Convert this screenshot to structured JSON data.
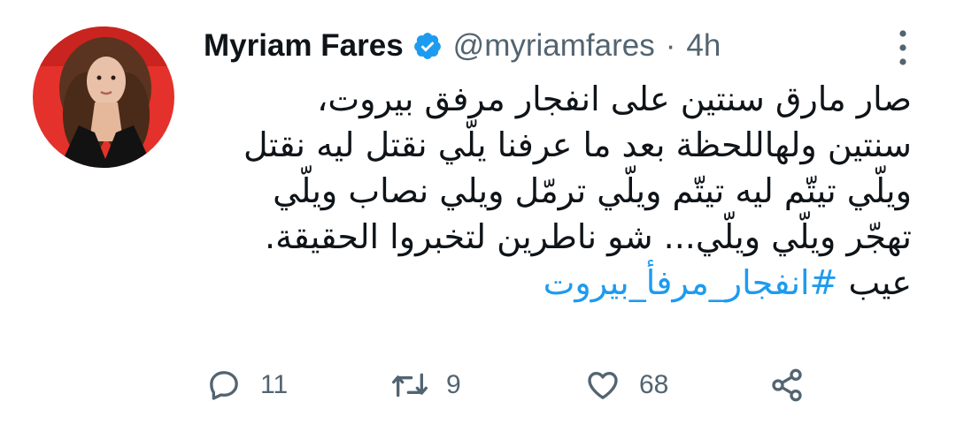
{
  "user": {
    "name": "Myriam Fares",
    "handle": "@myriamfares",
    "separator": "·",
    "time": "4h",
    "verified": true
  },
  "tweet": {
    "lines": [
      "صار مارق سنتين على انفجار مرفق بيروت،",
      "سنتين ولهاللحظة بعد ما عرفنا يلّي نقتل ليه نقتل",
      "ويلّي تيتّم ليه تيتّم  ويلّي ترمّل ويلي نصاب ويلّي",
      "تهجّر ويلّي ويلّي... شو ناطرين  لتخبروا الحقيقة."
    ],
    "last_line_text": "عيب ",
    "hashtag": "#انفجار_مرفأ_بيروت"
  },
  "actions": {
    "reply_count": "11",
    "retweet_count": "9",
    "like_count": "68"
  },
  "colors": {
    "accent": "#1d9bf0",
    "secondary_text": "#536471",
    "primary_text": "#0f1419"
  },
  "icons": [
    "verified-badge-icon",
    "more-options-icon",
    "reply-icon",
    "retweet-icon",
    "like-icon",
    "share-icon"
  ]
}
